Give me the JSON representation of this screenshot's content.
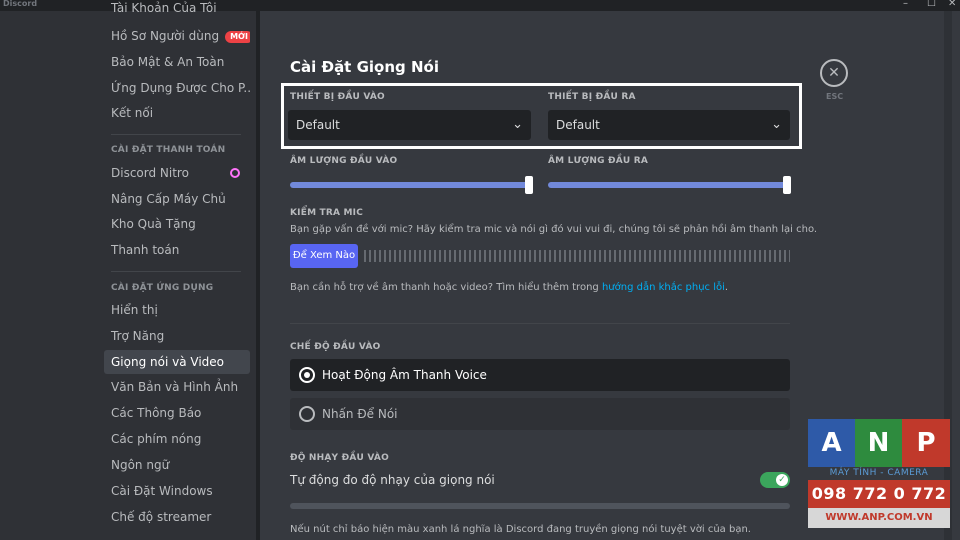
{
  "window": {
    "app_name": "Discord",
    "minimize": "–",
    "maximize": "☐",
    "close": "✕"
  },
  "sidebar": {
    "items": [
      {
        "label": "Tài Khoản Của Tôi"
      },
      {
        "label": "Hồ Sơ Người dùng",
        "badge": "MỚI"
      },
      {
        "label": "Bảo Mật & An Toàn"
      },
      {
        "label": "Ứng Dụng Được Cho P..."
      },
      {
        "label": "Kết nối"
      }
    ],
    "billing_header": "CÀI ĐẶT THANH TOÁN",
    "billing_items": [
      {
        "label": "Discord Nitro"
      },
      {
        "label": "Nâng Cấp Máy Chủ"
      },
      {
        "label": "Kho Quà Tặng"
      },
      {
        "label": "Thanh toán"
      }
    ],
    "app_header": "CÀI ĐẶT ỨNG DỤNG",
    "app_items": [
      {
        "label": "Hiển thị"
      },
      {
        "label": "Trợ Năng"
      },
      {
        "label": "Giọng nói và Video"
      },
      {
        "label": "Văn Bản và Hình Ảnh"
      },
      {
        "label": "Các Thông Báo"
      },
      {
        "label": "Các phím nóng"
      },
      {
        "label": "Ngôn ngữ"
      },
      {
        "label": "Cài Đặt Windows"
      },
      {
        "label": "Chế độ streamer"
      }
    ],
    "active_item": "Giọng nói và Video"
  },
  "main": {
    "title": "Cài Đặt Giọng Nói",
    "input_device": {
      "label": "THIẾT BỊ ĐẦU VÀO",
      "value": "Default"
    },
    "output_device": {
      "label": "THIẾT BỊ ĐẦU RA",
      "value": "Default"
    },
    "input_volume": {
      "label": "ÂM LƯỢNG ĐẦU VÀO",
      "level": 1.0
    },
    "output_volume": {
      "label": "ÂM LƯỢNG ĐẦU RA",
      "level": 1.0
    },
    "mic_test": {
      "label": "KIỂM TRA MIC",
      "description": "Bạn gặp vấn đề với mic? Hãy kiểm tra mic và nói gì đó vui vui đi, chúng tôi sẽ phản hồi âm thanh lại cho.",
      "button": "Để Xem Nào",
      "help_prefix": "Bạn cần hỗ trợ về âm thanh hoặc video? Tìm hiểu thêm trong ",
      "help_link": "hướng dẫn khắc phục lỗi",
      "help_suffix": "."
    },
    "input_mode": {
      "label": "CHẾ ĐỘ ĐẦU VÀO",
      "options": [
        "Hoạt Động Âm Thanh Voice",
        "Nhấn Để Nói"
      ],
      "selected": "Hoạt Động Âm Thanh Voice"
    },
    "sensitivity": {
      "label": "ĐỘ NHẠY ĐẦU VÀO",
      "auto_label": "Tự động đo độ nhạy của giọng nói",
      "auto_enabled": true,
      "note": "Nếu nút chỉ báo hiện màu xanh lá nghĩa là Discord đang truyền giọng nói tuyệt vời của bạn."
    },
    "close_button": "✕",
    "esc_label": "ESC"
  },
  "watermark": {
    "letters": [
      "A",
      "N",
      "P"
    ],
    "tagline": "MÁY TÍNH - CAMERA",
    "phone": "098 772 0 772",
    "website": "WWW.ANP.COM.VN",
    "colors": {
      "A": "#2e5aa8",
      "N": "#2e8b3e",
      "P": "#c0392b"
    }
  }
}
